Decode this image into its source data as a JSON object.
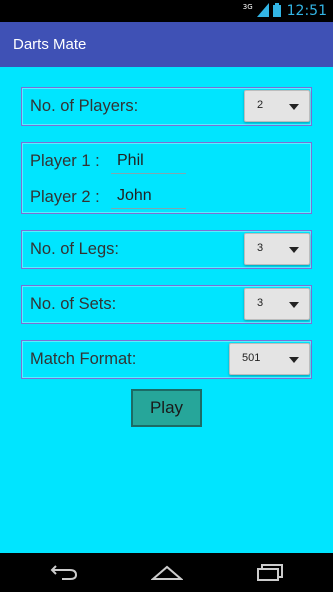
{
  "status_bar": {
    "network": "3G",
    "time": "12:51",
    "icons": [
      "signal-icon",
      "battery-icon"
    ]
  },
  "app": {
    "title": "Darts Mate"
  },
  "players": {
    "label": "No. of Players:",
    "value": "2"
  },
  "names": [
    {
      "label": "Player 1 :",
      "value": "Phil"
    },
    {
      "label": "Player 2 :",
      "value": "John"
    }
  ],
  "legs": {
    "label": "No. of Legs:",
    "value": "3"
  },
  "sets": {
    "label": "No. of Sets:",
    "value": "3"
  },
  "format": {
    "label": "Match Format:",
    "value": "501"
  },
  "play": {
    "label": "Play"
  },
  "nav": {
    "icons": [
      "back-icon",
      "home-icon",
      "recents-icon"
    ]
  },
  "colors": {
    "background": "#00e5ff",
    "action_bar": "#3f51b5",
    "button": "#26a69a"
  }
}
